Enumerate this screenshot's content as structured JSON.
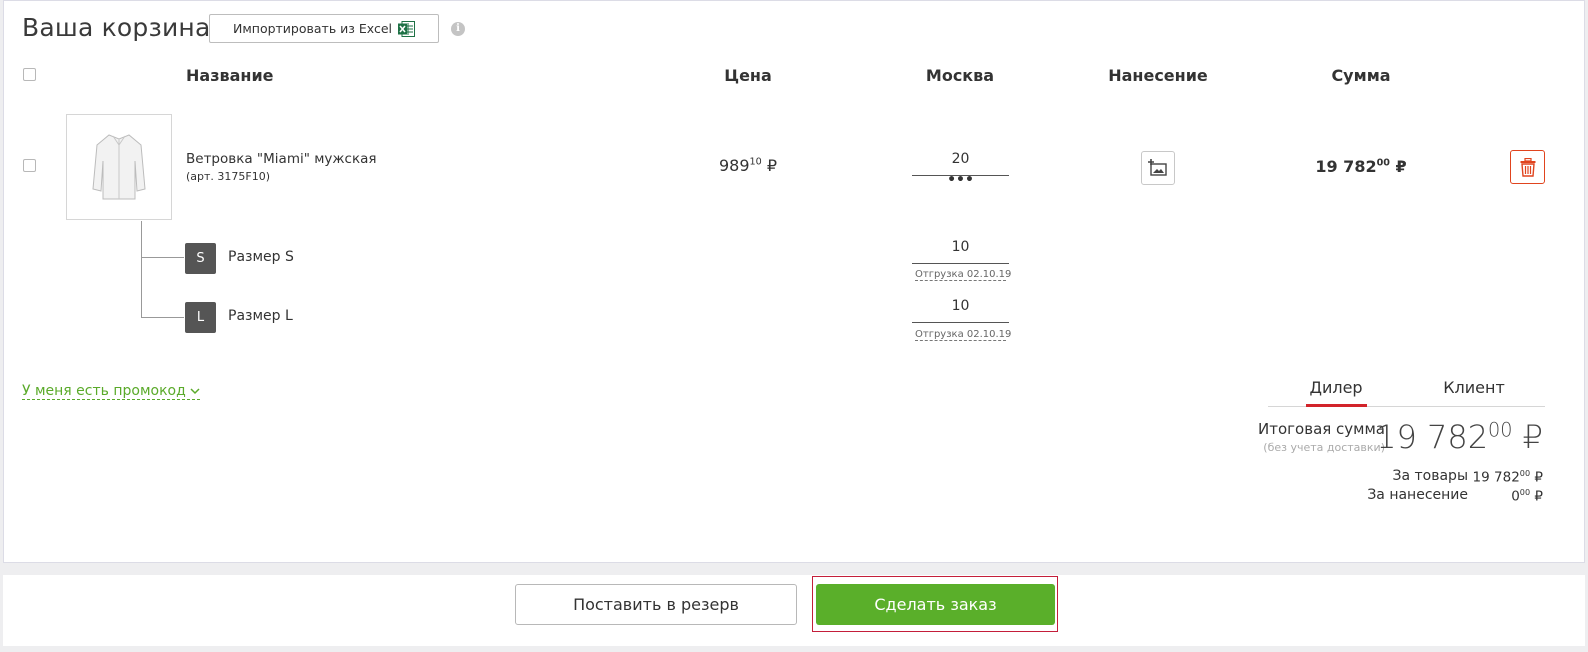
{
  "page": {
    "title": "Ваша корзина",
    "import_label": "Импортировать из Excel",
    "info_glyph": "i"
  },
  "table": {
    "headers": {
      "name": "Название",
      "price": "Цена",
      "city": "Москва",
      "print": "Нанесение",
      "sum": "Сумма"
    }
  },
  "item": {
    "name": "Ветровка \"Miami\" мужская",
    "article": "(арт. 3175F10)",
    "price_main": "989",
    "price_cents": "10",
    "currency": "₽",
    "qty": "20",
    "qty_more": "•••",
    "sum_main": "19 782",
    "sum_cents": "00"
  },
  "sizes": [
    {
      "badge": "S",
      "label": "Размер S",
      "qty": "10",
      "ship": "Отгрузка  02.10.19"
    },
    {
      "badge": "L",
      "label": "Размер L",
      "qty": "10",
      "ship": "Отгрузка  02.10.19"
    }
  ],
  "promo": {
    "label": "У меня есть промокод"
  },
  "tabs": {
    "dealer": "Дилер",
    "client": "Клиент",
    "active": "dealer"
  },
  "totals": {
    "label": "Итоговая сумма",
    "note": "(без учета доставки)",
    "value_main": "19 782",
    "value_cents": "00",
    "goods_label": "За товары",
    "goods_main": "19 782",
    "goods_cents": "00",
    "print_label": "За нанесение",
    "print_main": "0",
    "print_cents": "00",
    "currency": "₽"
  },
  "footer": {
    "reserve_label": "Поставить в резерв",
    "order_label": "Сделать заказ"
  },
  "colors": {
    "accent_green": "#5aaf2a",
    "accent_red": "#d2232a",
    "delete_orange": "#e0441e"
  },
  "icons": {
    "excel": "excel-icon",
    "info": "info-icon",
    "print": "add-print-icon",
    "delete": "trash-icon",
    "promo_chevron": "chevron-down-icon"
  }
}
